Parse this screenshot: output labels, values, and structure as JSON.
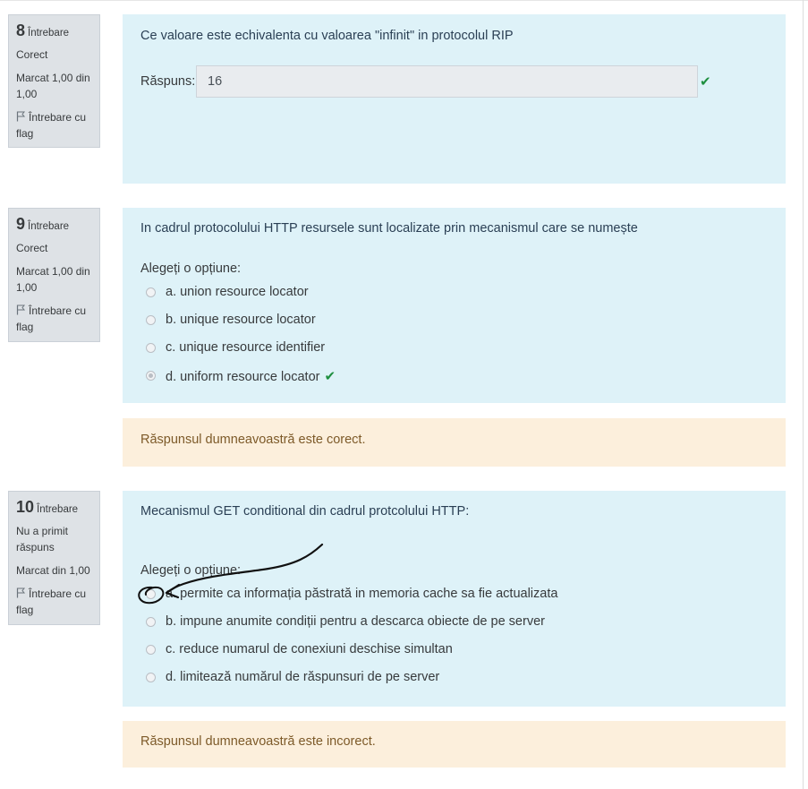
{
  "questions": [
    {
      "number": "8",
      "label": "Întrebare",
      "state": "Corect",
      "grade": "Marcat 1,00 din 1,00",
      "flag_label": "Întrebare cu flag",
      "text": "Ce valoare este echivalenta cu valoarea  \"infinit\" in protocolul RIP",
      "answer_label": "Răspuns:",
      "answer_value": "16",
      "answer_correct_icon": "check-icon"
    },
    {
      "number": "9",
      "label": "Întrebare",
      "state": "Corect",
      "grade": "Marcat 1,00 din 1,00",
      "flag_label": "Întrebare cu flag",
      "text": "In cadrul protocolului  HTTP resursele sunt localizate prin mecanismul care se numește",
      "prompt": "Alegeți o opțiune:",
      "options": [
        "a. union resource locator",
        "b. unique resource locator",
        "c. unique resource identifier",
        "d. uniform resource locator"
      ],
      "selected_option": "d. uniform resource locator",
      "feedback": "Răspunsul dumneavoastră este corect."
    },
    {
      "number": "10",
      "label": "Întrebare",
      "state": "Nu a primit răspuns",
      "grade": "Marcat din 1,00",
      "flag_label": "Întrebare cu flag",
      "text": "Mecanismul GET conditional din cadrul protcolului HTTP:",
      "prompt": "Alegeți o opțiune:",
      "options": [
        "a. permite ca informația păstrată in memoria cache sa fie actualizata",
        "b. impune anumite condiții pentru a descarca obiecte de pe server",
        "c. reduce numarul de conexiuni deschise simultan",
        "d. limitează numărul de răspunsuri de pe server"
      ],
      "feedback": "Răspunsul dumneavoastră este incorect."
    }
  ],
  "colors": {
    "formulation_bg": "#def2f8",
    "info_bg": "#dee2e6",
    "outcome_bg": "#fcefdc",
    "correct": "#1e8f3f",
    "annotation": "#111111"
  }
}
